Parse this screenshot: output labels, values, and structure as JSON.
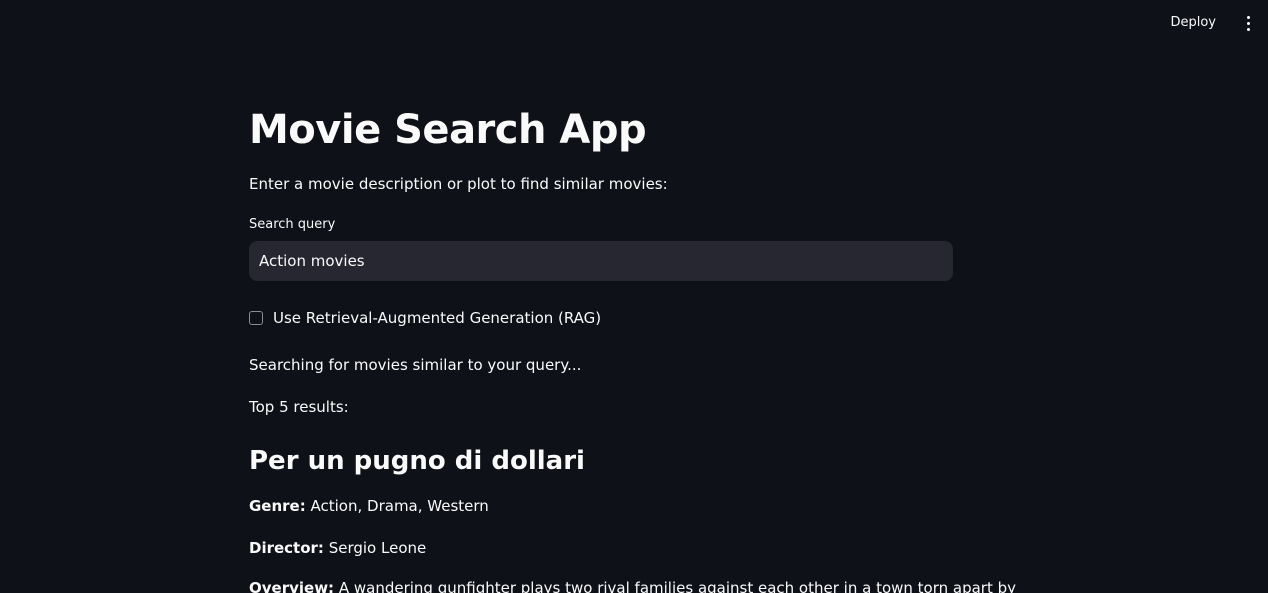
{
  "header": {
    "deploy_label": "Deploy",
    "menu_icon": "vertical-ellipsis-icon"
  },
  "main": {
    "title": "Movie Search App",
    "subtitle": "Enter a movie description or plot to find similar movies:",
    "search": {
      "label": "Search query",
      "value": "Action movies"
    },
    "rag_checkbox": {
      "label": "Use Retrieval-Augmented Generation (RAG)",
      "checked": false
    },
    "status_text": "Searching for movies similar to your query...",
    "results_count": "Top 5 results:",
    "results": [
      {
        "title": "Per un pugno di dollari",
        "genre_label": "Genre:",
        "genre": "Action, Drama, Western",
        "director_label": "Director:",
        "director": "Sergio Leone",
        "overview_label": "Overview:",
        "overview": "A wandering gunfighter plays two rival families against each other in a town torn apart by"
      }
    ]
  },
  "colors": {
    "background": "#0e1117",
    "text": "#fafafa",
    "input_background": "#262730"
  }
}
